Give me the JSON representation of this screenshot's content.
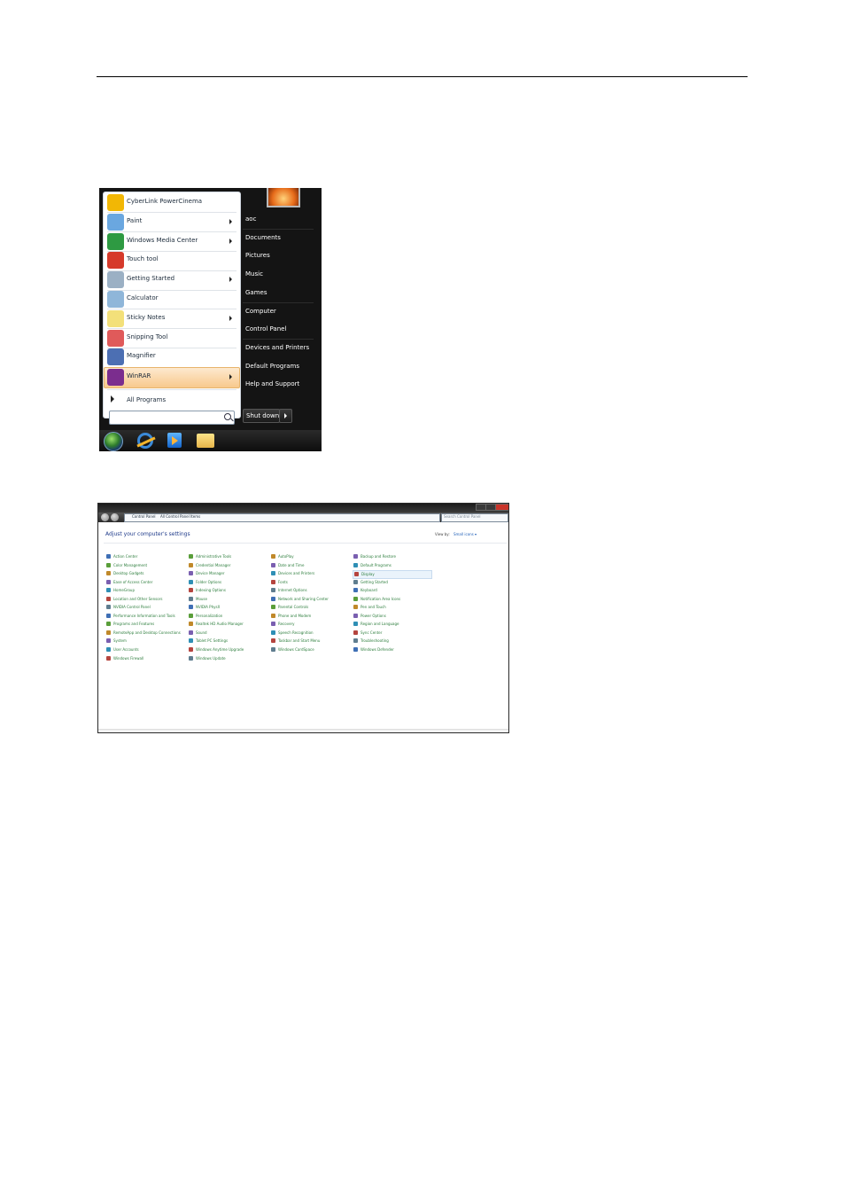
{
  "start_menu": {
    "programs": [
      {
        "label": "CyberLink PowerCinema",
        "icon": "powercinema-icon",
        "color": "#f2b705",
        "submenu": false
      },
      {
        "label": "Paint",
        "icon": "paint-icon",
        "color": "#6aa7e0",
        "submenu": true
      },
      {
        "label": "Windows Media Center",
        "icon": "media-center-icon",
        "color": "#2e9a42",
        "submenu": true
      },
      {
        "label": "Touch tool",
        "icon": "touch-tool-icon",
        "color": "#d63a2b",
        "submenu": false
      },
      {
        "label": "Getting Started",
        "icon": "getting-started-icon",
        "color": "#9bb0c4",
        "submenu": true
      },
      {
        "label": "Calculator",
        "icon": "calculator-icon",
        "color": "#8fb6d9",
        "submenu": false
      },
      {
        "label": "Sticky Notes",
        "icon": "sticky-notes-icon",
        "color": "#f3e07a",
        "submenu": true
      },
      {
        "label": "Snipping Tool",
        "icon": "snipping-tool-icon",
        "color": "#e05a5a",
        "submenu": false
      },
      {
        "label": "Magnifier",
        "icon": "magnifier-icon",
        "color": "#4c6fb3",
        "submenu": false
      },
      {
        "label": "WinRAR",
        "icon": "winrar-icon",
        "color": "#7b2d8e",
        "submenu": true,
        "highlighted": true
      }
    ],
    "all_programs": "All Programs",
    "search_placeholder": "",
    "right_items": [
      "aoc",
      "Documents",
      "Pictures",
      "Music",
      "Games",
      "Computer",
      "Control Panel",
      "Devices and Printers",
      "Default Programs",
      "Help and Support"
    ],
    "shutdown_label": "Shut down"
  },
  "taskbar": {
    "icons": [
      "start-orb-icon",
      "internet-explorer-icon",
      "media-player-icon",
      "folder-icon"
    ]
  },
  "control_panel": {
    "breadcrumb": [
      "Control Panel",
      "All Control Panel Items"
    ],
    "search_placeholder": "Search Control Panel",
    "heading": "Adjust your computer's settings",
    "view_by_label": "View by:",
    "view_by_value": "Small icons ▾",
    "columns": [
      [
        "Action Center",
        "Color Management",
        "Desktop Gadgets",
        "Ease of Access Center",
        "HomeGroup",
        "Location and Other Sensors",
        "NVIDIA Control Panel",
        "Performance Information and Tools",
        "Programs and Features",
        "RemoteApp and Desktop Connections",
        "System",
        "User Accounts",
        "Windows Firewall"
      ],
      [
        "Administrative Tools",
        "Credential Manager",
        "Device Manager",
        "Folder Options",
        "Indexing Options",
        "Mouse",
        "NVIDIA PhysX",
        "Personalization",
        "Realtek HD Audio Manager",
        "Sound",
        "Tablet PC Settings",
        "Windows Anytime Upgrade",
        "Windows Update"
      ],
      [
        "AutoPlay",
        "Date and Time",
        "Devices and Printers",
        "Fonts",
        "Internet Options",
        "Network and Sharing Center",
        "Parental Controls",
        "Phone and Modem",
        "Recovery",
        "Speech Recognition",
        "Taskbar and Start Menu",
        "Windows CardSpace"
      ],
      [
        "Backup and Restore",
        "Default Programs",
        "Display",
        "Getting Started",
        "Keyboard",
        "Notification Area Icons",
        "Pen and Touch",
        "Power Options",
        "Region and Language",
        "Sync Center",
        "Troubleshooting",
        "Windows Defender"
      ]
    ],
    "selected_item": "Display",
    "link_color": "#2c7d3c"
  }
}
